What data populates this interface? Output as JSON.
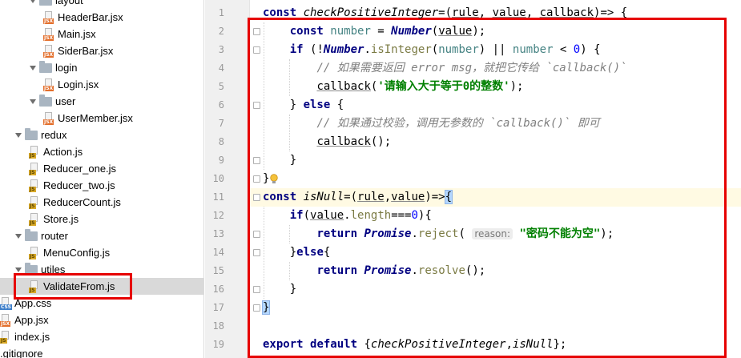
{
  "tree": [
    {
      "label": "layout",
      "kind": "folder",
      "indent": 1,
      "arrow": "down"
    },
    {
      "label": "HeaderBar.jsx",
      "kind": "jsx",
      "indent": 2
    },
    {
      "label": "Main.jsx",
      "kind": "jsx",
      "indent": 2
    },
    {
      "label": "SiderBar.jsx",
      "kind": "jsx",
      "indent": 2
    },
    {
      "label": "login",
      "kind": "folder",
      "indent": 1,
      "arrow": "down"
    },
    {
      "label": "Login.jsx",
      "kind": "jsx",
      "indent": 2
    },
    {
      "label": "user",
      "kind": "folder",
      "indent": 1,
      "arrow": "down"
    },
    {
      "label": "UserMember.jsx",
      "kind": "jsx",
      "indent": 2
    },
    {
      "label": "redux",
      "kind": "folder",
      "indent": 0,
      "arrow": "down"
    },
    {
      "label": "Action.js",
      "kind": "js",
      "indent": 1
    },
    {
      "label": "Reducer_one.js",
      "kind": "js",
      "indent": 1
    },
    {
      "label": "Reducer_two.js",
      "kind": "js",
      "indent": 1
    },
    {
      "label": "ReducerCount.js",
      "kind": "js",
      "indent": 1
    },
    {
      "label": "Store.js",
      "kind": "js",
      "indent": 1
    },
    {
      "label": "router",
      "kind": "folder",
      "indent": 0,
      "arrow": "down"
    },
    {
      "label": "MenuConfig.js",
      "kind": "js",
      "indent": 1
    },
    {
      "label": "utiles",
      "kind": "folder",
      "indent": 0,
      "arrow": "down"
    },
    {
      "label": "ValidateFrom.js",
      "kind": "js",
      "indent": 1,
      "selected": true
    },
    {
      "label": "App.css",
      "kind": "css",
      "indent": -1
    },
    {
      "label": "App.jsx",
      "kind": "jsx",
      "indent": -1
    },
    {
      "label": "index.js",
      "kind": "js",
      "indent": -1
    },
    {
      "label": ".gitignore",
      "kind": "plain",
      "indent": -2
    }
  ],
  "file_tags": {
    "jsx": "JSX",
    "js": "JS",
    "css": "CSS"
  },
  "line_numbers": [
    "1",
    "2",
    "3",
    "4",
    "5",
    "6",
    "7",
    "8",
    "9",
    "10",
    "11",
    "12",
    "13",
    "14",
    "15",
    "16",
    "17",
    "18",
    "19"
  ],
  "code_lines": [
    [
      {
        "t": "const ",
        "c": "kw"
      },
      {
        "t": "checkPositiveInteger",
        "c": "fn"
      },
      {
        "t": "=("
      },
      {
        "t": "rule",
        "c": "par-u"
      },
      {
        "t": ", "
      },
      {
        "t": "value",
        "c": "par-u"
      },
      {
        "t": ", "
      },
      {
        "t": "callback",
        "c": "par-u"
      },
      {
        "t": ")=> {"
      }
    ],
    [
      {
        "t": "    "
      },
      {
        "t": "const ",
        "c": "kw"
      },
      {
        "t": "number",
        "c": "par"
      },
      {
        "t": " = "
      },
      {
        "t": "Number",
        "c": "cls"
      },
      {
        "t": "("
      },
      {
        "t": "value",
        "c": "par-u"
      },
      {
        "t": ");"
      }
    ],
    [
      {
        "t": "    "
      },
      {
        "t": "if ",
        "c": "kw"
      },
      {
        "t": "(!"
      },
      {
        "t": "Number",
        "c": "cls"
      },
      {
        "t": "."
      },
      {
        "t": "isInteger",
        "c": "mem"
      },
      {
        "t": "("
      },
      {
        "t": "number",
        "c": "par"
      },
      {
        "t": ") || "
      },
      {
        "t": "number",
        "c": "par"
      },
      {
        "t": " < "
      },
      {
        "t": "0",
        "c": "num"
      },
      {
        "t": ") {"
      }
    ],
    [
      {
        "t": "        "
      },
      {
        "t": "// 如果需要返回 error msg，就把它传给 `callback()`",
        "c": "cmt"
      }
    ],
    [
      {
        "t": "        "
      },
      {
        "t": "callback",
        "c": "call"
      },
      {
        "t": "("
      },
      {
        "t": "'请输入大于等于0的整数'",
        "c": "str"
      },
      {
        "t": ");"
      }
    ],
    [
      {
        "t": "    } "
      },
      {
        "t": "else ",
        "c": "kw"
      },
      {
        "t": "{"
      }
    ],
    [
      {
        "t": "        "
      },
      {
        "t": "// 如果通过校验，调用无参数的 `callback()` 即可",
        "c": "cmt"
      }
    ],
    [
      {
        "t": "        "
      },
      {
        "t": "callback",
        "c": "call"
      },
      {
        "t": "();"
      }
    ],
    [
      {
        "t": "    }"
      }
    ],
    [
      {
        "t": "}"
      }
    ],
    [
      {
        "t": "const ",
        "c": "kw"
      },
      {
        "t": "isNull",
        "c": "fn"
      },
      {
        "t": "=("
      },
      {
        "t": "rule",
        "c": "par-u"
      },
      {
        "t": ","
      },
      {
        "t": "value",
        "c": "par-u"
      },
      {
        "t": ")=>"
      },
      {
        "t": "{",
        "c": "bracket-hl"
      }
    ],
    [
      {
        "t": "    "
      },
      {
        "t": "if",
        "c": "kw"
      },
      {
        "t": "("
      },
      {
        "t": "value",
        "c": "par-u"
      },
      {
        "t": "."
      },
      {
        "t": "length",
        "c": "mem"
      },
      {
        "t": "==="
      },
      {
        "t": "0",
        "c": "num"
      },
      {
        "t": "){"
      }
    ],
    [
      {
        "t": "        "
      },
      {
        "t": "return ",
        "c": "kw"
      },
      {
        "t": "Promise",
        "c": "cls"
      },
      {
        "t": "."
      },
      {
        "t": "reject",
        "c": "mem"
      },
      {
        "t": "( "
      },
      {
        "t": "reason:",
        "c": "hint"
      },
      {
        "t": " "
      },
      {
        "t": "\"密码不能为空\"",
        "c": "str"
      },
      {
        "t": ");"
      }
    ],
    [
      {
        "t": "    }"
      },
      {
        "t": "else",
        "c": "kw"
      },
      {
        "t": "{"
      }
    ],
    [
      {
        "t": "        "
      },
      {
        "t": "return ",
        "c": "kw"
      },
      {
        "t": "Promise",
        "c": "cls"
      },
      {
        "t": "."
      },
      {
        "t": "resolve",
        "c": "mem"
      },
      {
        "t": "();"
      }
    ],
    [
      {
        "t": "    }"
      }
    ],
    [
      {
        "t": "}",
        "c": "bracket-hl"
      }
    ],
    [
      {
        "t": ""
      }
    ],
    [
      {
        "t": "export ",
        "c": "kw"
      },
      {
        "t": "default ",
        "c": "kw"
      },
      {
        "t": "{"
      },
      {
        "t": "checkPositiveInteger",
        "c": "fn"
      },
      {
        "t": ","
      },
      {
        "t": "isNull",
        "c": "fn"
      },
      {
        "t": "};"
      }
    ]
  ],
  "current_line": 11,
  "fold_lines": [
    2,
    3,
    6,
    9,
    10,
    11,
    13,
    14,
    16,
    17
  ],
  "colors": {
    "annotation": "#e60000",
    "current_line": "#fffae3",
    "selection": "#d9d9d9"
  },
  "icons": {
    "folder": "folder-icon",
    "file": "file-icon",
    "arrow": "chevron-down-icon",
    "bulb": "lightbulb-icon"
  }
}
